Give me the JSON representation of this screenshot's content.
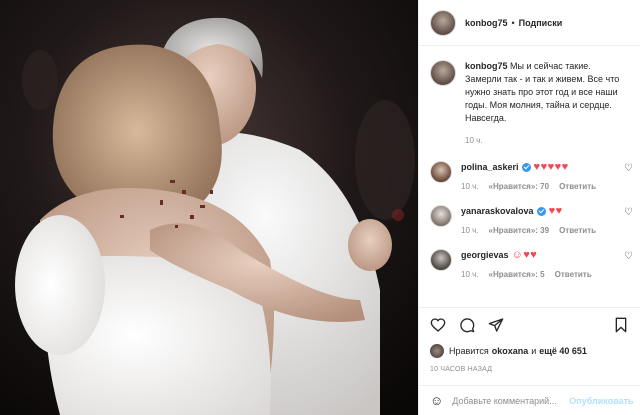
{
  "post": {
    "author": "konbog75",
    "separator": "•",
    "follow_label": "Подписки",
    "caption_text": "Мы и сейчас такие. Замерли так - и так и живем. Все что нужно знать про этот год и все наши годы. Моя молния, тайна и сердце. Навсегда.",
    "caption_time": "10 ч."
  },
  "comments": [
    {
      "user": "polina_askeri",
      "verified": true,
      "text": "♥♥♥♥♥",
      "time": "10 ч.",
      "likes": "«Нравится»: 70",
      "reply": "Ответить"
    },
    {
      "user": "yanaraskovalova",
      "verified": true,
      "text": "♥♥",
      "time": "10 ч.",
      "likes": "«Нравится»: 39",
      "reply": "Ответить"
    },
    {
      "user": "georgievas",
      "verified": false,
      "text": "☺♥♥",
      "time": "10 ч.",
      "likes": "«Нравится»: 5",
      "reply": "Ответить"
    }
  ],
  "actions": {
    "liked_prefix": "Нравится",
    "liked_user": "okoxana",
    "liked_middle": "и",
    "liked_others": "ещё 40 651",
    "ago": "10 ЧАСОВ НАЗАД"
  },
  "composer": {
    "placeholder": "Добавьте комментарий...",
    "publish_label": "Опубликовать"
  },
  "icons": {
    "like": "heart-icon",
    "comment": "comment-icon",
    "share": "share-icon",
    "save": "bookmark-icon",
    "emoji": "smiley-icon",
    "comment_like": "heart-outline-icon"
  },
  "colors": {
    "heart": "#ed4956",
    "verified": "#3897f0",
    "muted": "#8e8e8e",
    "publish_disabled": "#b2dffc"
  }
}
